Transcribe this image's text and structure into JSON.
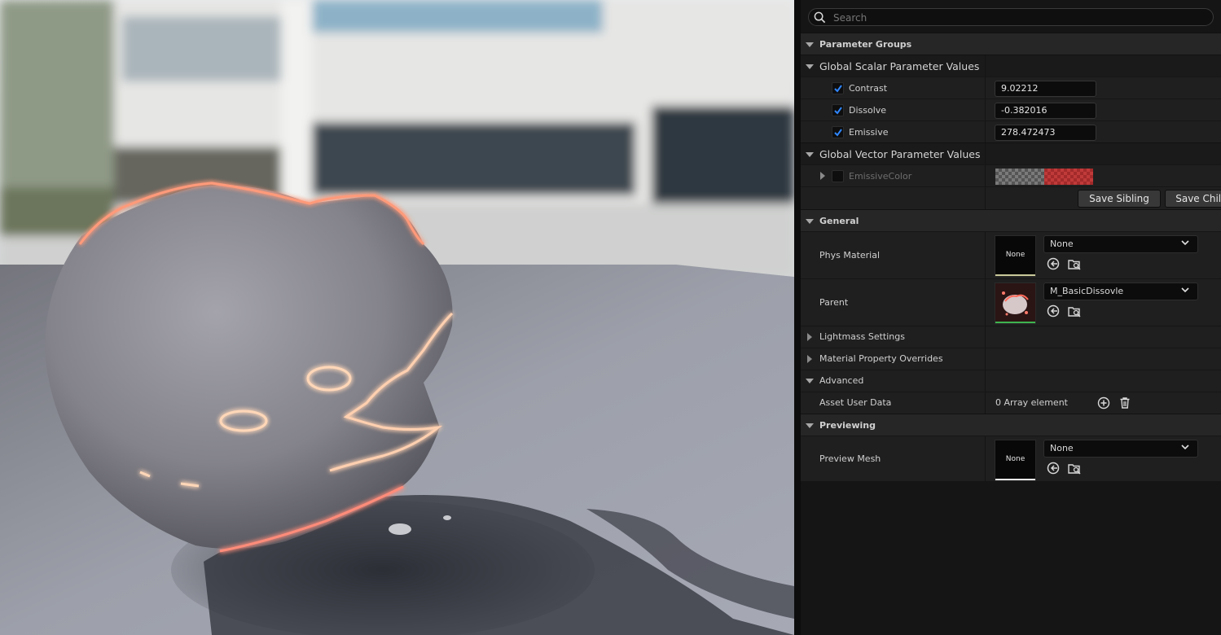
{
  "search": {
    "placeholder": "Search"
  },
  "sections": {
    "parameter_groups": "Parameter Groups",
    "scalar_group": "Global Scalar Parameter Values",
    "vector_group": "Global Vector Parameter Values",
    "general": "General",
    "lightmass": "Lightmass Settings",
    "overrides": "Material Property Overrides",
    "advanced": "Advanced",
    "previewing": "Previewing"
  },
  "scalar_params": [
    {
      "name": "Contrast",
      "value": "9.02212",
      "enabled": true
    },
    {
      "name": "Dissolve",
      "value": "-0.382016",
      "enabled": true
    },
    {
      "name": "Emissive",
      "value": "278.472473",
      "enabled": true
    }
  ],
  "vector_params": [
    {
      "name": "EmissiveColor",
      "enabled": false,
      "color": "#c83232"
    }
  ],
  "buttons": {
    "save_sibling": "Save Sibling",
    "save_child": "Save Child"
  },
  "general": {
    "phys_material": {
      "label": "Phys Material",
      "thumb": "None",
      "value": "None"
    },
    "parent": {
      "label": "Parent",
      "value": "M_BasicDissovle"
    }
  },
  "advanced": {
    "asset_user_data": {
      "label": "Asset User Data",
      "value": "0 Array element"
    }
  },
  "previewing": {
    "preview_mesh": {
      "label": "Preview Mesh",
      "thumb": "None",
      "value": "None"
    }
  },
  "colors": {
    "accent_check": "#1e6fd8",
    "panel_bg": "#151515",
    "category_bg": "#262626",
    "glow": "#ff4a3a"
  }
}
